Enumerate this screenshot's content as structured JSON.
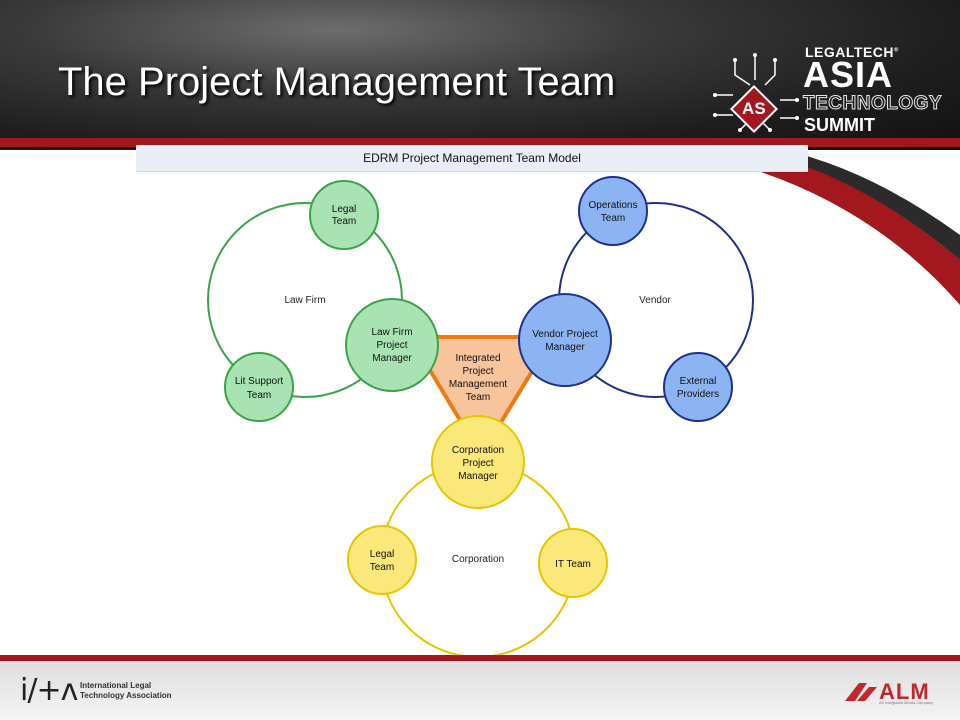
{
  "slide": {
    "title": "The Project Management Team"
  },
  "header_logo": {
    "legaltech": "LEGALTECH",
    "asia": "ASIA",
    "technology": "TECHNOLOGY",
    "summit": "SUMMIT",
    "badge": "AS"
  },
  "diagram": {
    "title": "EDRM Project Management Team Model",
    "groups": {
      "law_firm": "Law Firm",
      "vendor": "Vendor",
      "corporation": "Corporation"
    },
    "nodes": {
      "law_legal": [
        "Legal",
        "Team"
      ],
      "law_litsupport": [
        "Lit Support",
        "Team"
      ],
      "law_pm": [
        "Law Firm",
        "Project",
        "Manager"
      ],
      "vendor_ops": [
        "Operations",
        "Team"
      ],
      "vendor_ext": [
        "External",
        "Providers"
      ],
      "vendor_pm": [
        "Vendor Project",
        "Manager"
      ],
      "corp_pm": [
        "Corporation",
        "Project",
        "Manager"
      ],
      "corp_legal": [
        "Legal",
        "Team"
      ],
      "corp_it": [
        "IT Team"
      ],
      "integrated": [
        "Integrated",
        "Project",
        "Management",
        "Team"
      ]
    },
    "colors": {
      "law_fill": "#a9e3b3",
      "law_stroke": "#3aa34a",
      "vendor_fill": "#8cb4f2",
      "vendor_stroke": "#1f2f8f",
      "corp_fill": "#fbe87a",
      "corp_stroke": "#e8c400",
      "integrated_fill": "#f8c49c",
      "integrated_stroke": "#ef7a14"
    }
  },
  "footer": {
    "ilta_mark": "i/+ʌ",
    "ilta_line1": "International Legal",
    "ilta_line2": "Technology Association",
    "alm_word": "ALM",
    "alm_tag": "An Integrated Media Company"
  },
  "brand_colors": {
    "red": "#a3171e",
    "dark": "#1e1e1e"
  }
}
